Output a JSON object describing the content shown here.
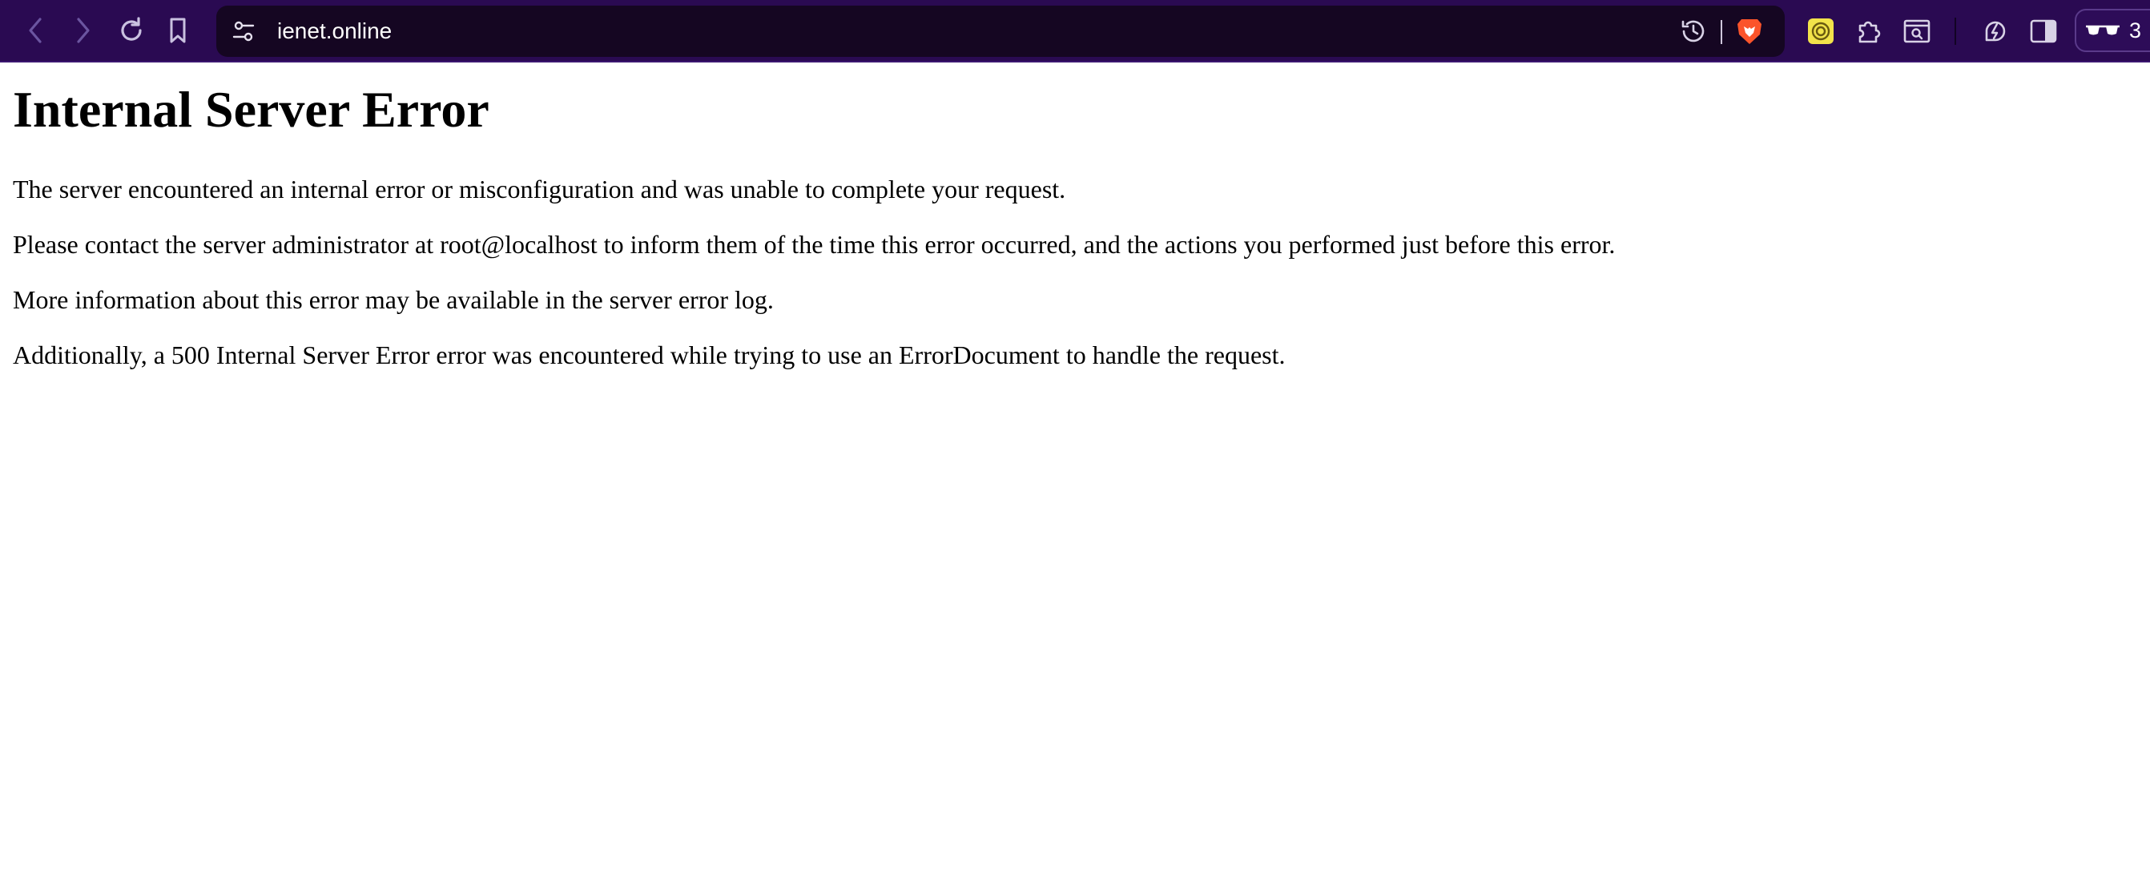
{
  "browser": {
    "url": "ienet.online",
    "toolbar_icons": {
      "back": "chevron-left-icon",
      "forward": "chevron-right-icon",
      "reload": "reload-icon",
      "bookmark": "bookmark-icon",
      "site_settings": "tune-icon",
      "history": "history-icon",
      "brave_shields": "brave-lion-icon",
      "extension_yellow": "extension-badge-icon",
      "extensions": "puzzle-icon",
      "reader": "reader-mode-icon",
      "leo": "leo-ai-icon",
      "sidebar": "sidebar-icon",
      "private": "glasses-icon"
    },
    "profile_count": "3",
    "colors": {
      "toolbar_bg": "#2a0a52",
      "urlbar_bg": "#150622",
      "brave_orange": "#fb542b",
      "extension_yellow": "#f2e34a"
    }
  },
  "page": {
    "title": "Internal Server Error",
    "paragraphs": [
      "The server encountered an internal error or misconfiguration and was unable to complete your request.",
      "Please contact the server administrator at root@localhost to inform them of the time this error occurred, and the actions you performed just before this error.",
      "More information about this error may be available in the server error log.",
      "Additionally, a 500 Internal Server Error error was encountered while trying to use an ErrorDocument to handle the request."
    ]
  }
}
